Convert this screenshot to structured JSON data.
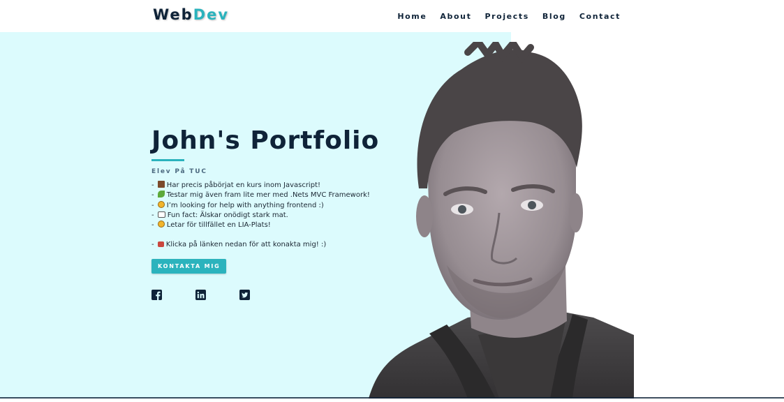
{
  "header": {
    "logo_main": "Web",
    "logo_accent": "Dev",
    "nav": [
      {
        "label": "Home"
      },
      {
        "label": "About"
      },
      {
        "label": "Projects"
      },
      {
        "label": "Blog"
      },
      {
        "label": "Contact"
      }
    ]
  },
  "hero": {
    "title": "John's Portfolio",
    "subtitle": "Elev På TUC",
    "bullets": [
      {
        "prefix": "-",
        "icon": "hammer-icon",
        "text": "Har precis påbörjat en kurs inom Javascript!"
      },
      {
        "prefix": "-",
        "icon": "seedling-icon",
        "text": "Testar mig även fram lite mer med .Nets MVC Framework!"
      },
      {
        "prefix": "-",
        "icon": "confused-face-icon",
        "text": "I’m looking for help with anything frontend :)"
      },
      {
        "prefix": "-",
        "icon": "speech-bubble-icon",
        "text": "Fun fact: Älskar onödigt stark mat."
      },
      {
        "prefix": "-",
        "icon": "grinning-face-icon",
        "text": "Letar för tillfället en LIA-Plats!"
      },
      {
        "prefix": "-",
        "icon": "mailbox-icon",
        "text": "Klicka på länken nedan för att konakta mig! :)"
      }
    ],
    "cta_label": "KONTAKTA MIG",
    "socials": [
      "facebook-icon",
      "linkedin-icon",
      "twitter-icon"
    ]
  },
  "colors": {
    "brand_dark": "#0f2338",
    "accent": "#2bb3bd",
    "hero_bg": "#dcfbfd"
  }
}
